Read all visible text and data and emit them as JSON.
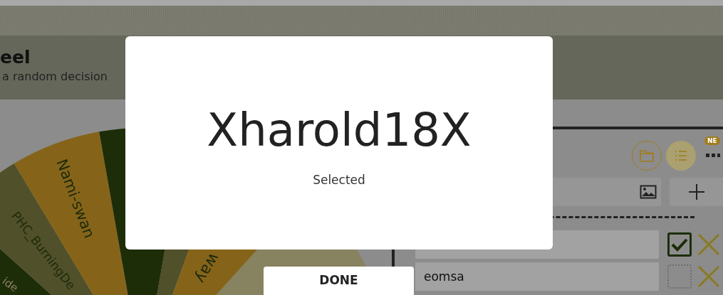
{
  "header": {
    "title": "eel",
    "subtitle": "a random decision"
  },
  "wheel": {
    "slices": [
      {
        "label": "ide",
        "color": "#1c2d08"
      },
      {
        "label": "PHC_BurningDe",
        "color": "#50502a"
      },
      {
        "label": "Nami-swan",
        "color": "#85641a"
      },
      {
        "color": "#1c2d08"
      },
      {
        "color": "#50502a"
      },
      {
        "label": "way",
        "color": "#85641a"
      },
      {
        "color": "#87825f"
      }
    ]
  },
  "toolbar": {
    "badge": "NE"
  },
  "entries": [
    {
      "checked": true
    },
    {
      "value": "eomsa",
      "checked": false
    }
  ],
  "dialog": {
    "title": "Xharold18X",
    "subtitle": "Selected",
    "button": "DONE"
  }
}
